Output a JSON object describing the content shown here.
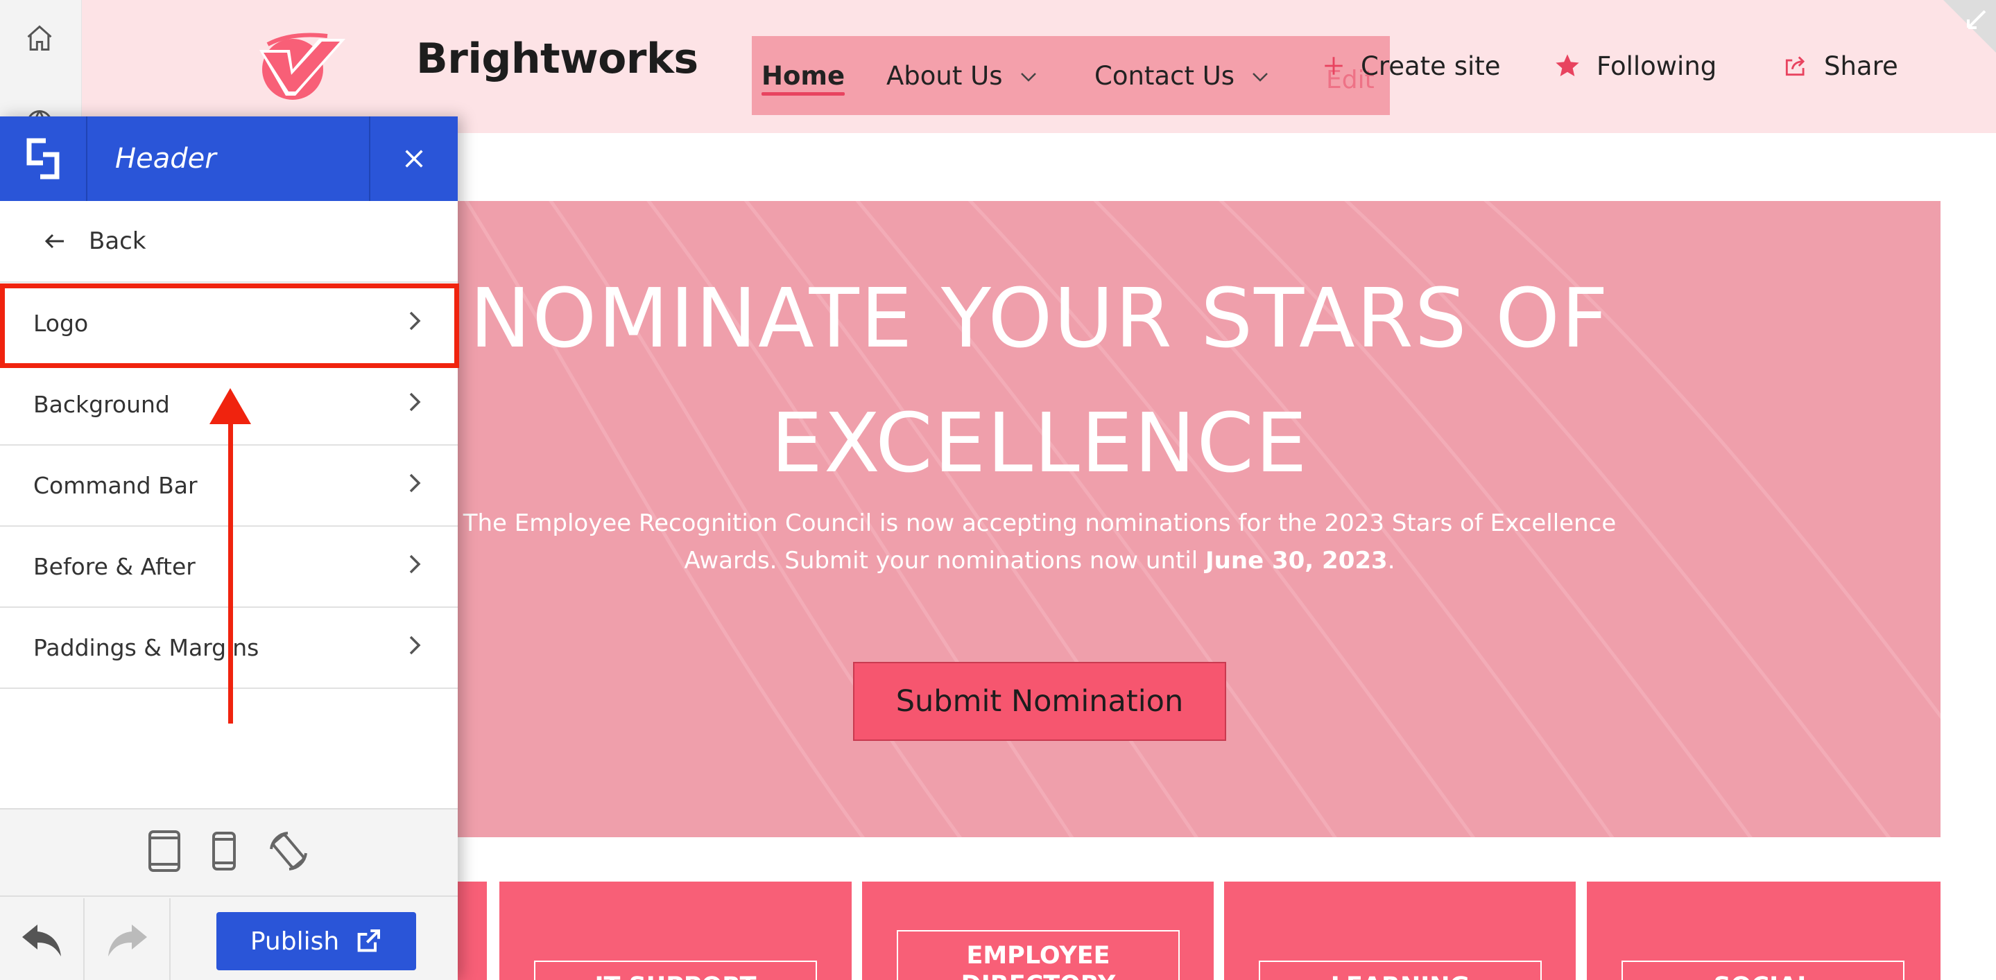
{
  "site": {
    "title": "Brightworks",
    "nav": [
      {
        "label": "Home",
        "active": true
      },
      {
        "label": "About Us",
        "dropdown": true
      },
      {
        "label": "Contact Us",
        "dropdown": true
      }
    ],
    "nav_edit": "Edit",
    "commands": {
      "create": "Create site",
      "following": "Following",
      "share": "Share"
    }
  },
  "hero": {
    "title_line1": "NOMINATE YOUR STARS OF",
    "title_line2": "EXCELLENCE",
    "desc_line1": "The Employee Recognition Council is now accepting nominations for the 2023 Stars of Excellence",
    "desc_line2_prefix": "Awards. Submit your nominations now until ",
    "desc_deadline": "June 30, 2023",
    "desc_suffix": ".",
    "button": "Submit Nomination"
  },
  "tiles": [
    {
      "line1": "IT SUPPORT",
      "line2": ""
    },
    {
      "line1": "EMPLOYEE",
      "line2": "DIRECTORY"
    },
    {
      "line1": "LEARNING",
      "line2": ""
    },
    {
      "line1": "SOCIAL",
      "line2": ""
    }
  ],
  "panel": {
    "title": "Header",
    "back": "Back",
    "items": [
      {
        "label": "Logo"
      },
      {
        "label": "Background"
      },
      {
        "label": "Command Bar"
      },
      {
        "label": "Before & After"
      },
      {
        "label": "Paddings & Margins"
      }
    ],
    "publish": "Publish"
  },
  "colors": {
    "accent_blue": "#2a55d8",
    "brand_pink": "#f85f77",
    "highlight_red": "#f0230e"
  }
}
